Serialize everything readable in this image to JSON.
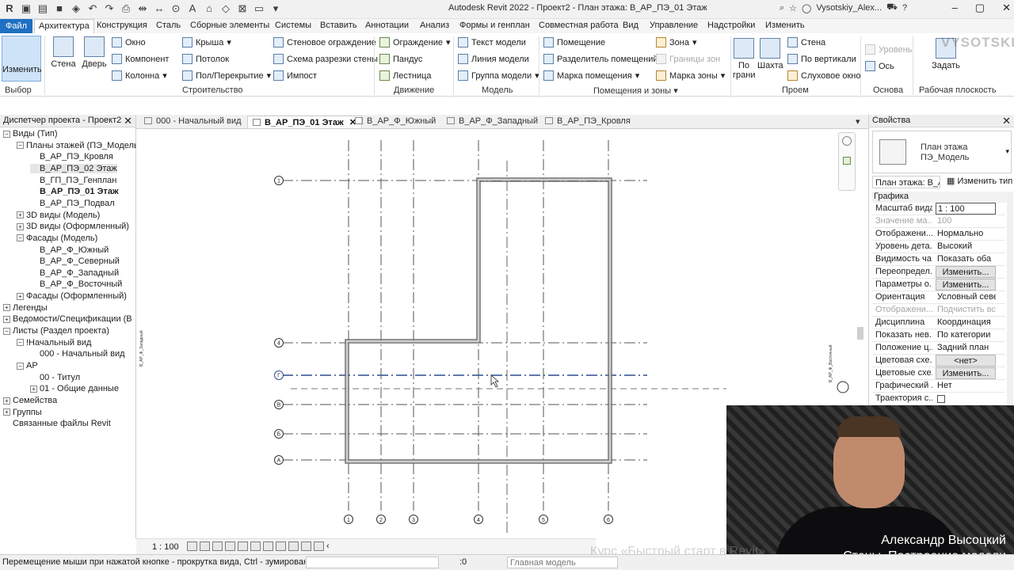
{
  "window": {
    "title": "Autodesk Revit 2022 - Проект2 - План этажа: В_АР_ПЭ_01 Этаж",
    "user": "Vysotskiy_Alex...",
    "logo_text": "VYSOTSKIY"
  },
  "menu": {
    "file": "Файл",
    "tabs": [
      "Архитектура",
      "Конструкция",
      "Сталь",
      "Сборные элементы",
      "Системы",
      "Вставить",
      "Аннотации",
      "Анализ",
      "Формы и генплан",
      "Совместная работа",
      "Вид",
      "Управление",
      "Надстройки",
      "Изменить"
    ],
    "active": "Архитектура"
  },
  "ribbon": {
    "modify": "Изменить",
    "select": "Выбор",
    "wall": "Стена",
    "door": "Дверь",
    "window": "Окно",
    "component": "Компонент",
    "column": "Колонна",
    "roof": "Крыша",
    "ceiling": "Потолок",
    "floor": "Пол/Перекрытие",
    "curtain_system": "Стеновое ограждение",
    "curtain_grid": "Схема разрезки стены",
    "mullion": "Импост",
    "railing": "Ограждение",
    "ramp": "Пандус",
    "stair": "Лестница",
    "model_text": "Текст модели",
    "model_line": "Линия модели",
    "model_group": "Группа модели",
    "room": "Помещение",
    "room_separator": "Разделитель помещений",
    "room_tag": "Марка помещения",
    "area": "Зона",
    "area_boundary": "Границы зон",
    "area_tag": "Марка зоны",
    "by_face": "По грани",
    "shaft": "Шахта",
    "opening_wall": "Стена",
    "vertical": "По вертикали",
    "dormer": "Слуховое окно",
    "level": "Уровень",
    "grid": "Ось",
    "set": "Задать",
    "panels": {
      "build": "Строительство",
      "circulation": "Движение",
      "model": "Модель",
      "room_area": "Помещения и зоны",
      "opening": "Проем",
      "datum": "Основа",
      "workplane": "Рабочая плоскость"
    }
  },
  "project_browser": {
    "title": "Диспетчер проекта - Проект2",
    "items": [
      {
        "label": "Виды (Тип)",
        "level": 0,
        "toggle": "−"
      },
      {
        "label": "Планы этажей (ПЭ_Модель",
        "level": 1,
        "toggle": "−"
      },
      {
        "label": "В_АР_ПЭ_Кровля",
        "level": 2
      },
      {
        "label": "В_АР_ПЭ_02 Этаж",
        "level": 2,
        "selected": true
      },
      {
        "label": "В_ГП_ПЭ_Генплан",
        "level": 2
      },
      {
        "label": "В_АР_ПЭ_01 Этаж",
        "level": 2,
        "bold": true
      },
      {
        "label": "В_АР_ПЭ_Подвал",
        "level": 2
      },
      {
        "label": "3D виды (Модель)",
        "level": 1,
        "toggle": "+"
      },
      {
        "label": "3D виды (Оформленный)",
        "level": 1,
        "toggle": "+"
      },
      {
        "label": "Фасады (Модель)",
        "level": 1,
        "toggle": "−"
      },
      {
        "label": "В_АР_Ф_Южный",
        "level": 2
      },
      {
        "label": "В_АР_Ф_Северный",
        "level": 2
      },
      {
        "label": "В_АР_Ф_Западный",
        "level": 2
      },
      {
        "label": "В_АР_Ф_Восточный",
        "level": 2
      },
      {
        "label": "Фасады (Оформленный)",
        "level": 1,
        "toggle": "+"
      },
      {
        "label": "Легенды",
        "level": 0,
        "toggle": "+"
      },
      {
        "label": "Ведомости/Спецификации (В",
        "level": 0,
        "toggle": "+"
      },
      {
        "label": "Листы (Раздел проекта)",
        "level": 0,
        "toggle": "−"
      },
      {
        "label": "!Начальный вид",
        "level": 1,
        "toggle": "−"
      },
      {
        "label": "000 - Начальный вид",
        "level": 2
      },
      {
        "label": "АР",
        "level": 1,
        "toggle": "−"
      },
      {
        "label": "00 - Титул",
        "level": 2
      },
      {
        "label": "01 - Общие данные",
        "level": 2,
        "toggle": "+"
      },
      {
        "label": "Семейства",
        "level": 0,
        "toggle": "+"
      },
      {
        "label": "Группы",
        "level": 0,
        "toggle": "+"
      },
      {
        "label": "Связанные файлы Revit",
        "level": 0
      }
    ]
  },
  "view_tabs": [
    {
      "label": "000 - Начальный вид"
    },
    {
      "label": "В_АР_ПЭ_01 Этаж",
      "active": true
    },
    {
      "label": "В_АР_Ф_Южный"
    },
    {
      "label": "В_АР_Ф_Западный"
    },
    {
      "label": "В_АР_ПЭ_Кровля"
    }
  ],
  "drawing": {
    "horizontal_grids": [
      "1",
      "4",
      "Г",
      "В",
      "Б",
      "А"
    ],
    "vertical_grids": [
      "1",
      "2",
      "3",
      "4",
      "5",
      "6"
    ],
    "left_elevation_tag": "В_АР_Ф_Западный",
    "right_elevation_tag": "В_АР_Ф_Восточный",
    "accent_color": "#2a4d8f"
  },
  "properties": {
    "title": "Свойства",
    "type_name_1": "План этажа",
    "type_name_2": "ПЭ_Модель",
    "instance_selector": "План этажа: В_А",
    "edit_type": "Изменить тип",
    "section": "Графика",
    "rows": [
      {
        "key": "Масштаб вида",
        "value": "1 : 100",
        "kind": "field"
      },
      {
        "key": "Значение ма...",
        "value": "100",
        "kind": "dis"
      },
      {
        "key": "Отображени...",
        "value": "Нормально"
      },
      {
        "key": "Уровень дета...",
        "value": "Высокий"
      },
      {
        "key": "Видимость ча...",
        "value": "Показать оба"
      },
      {
        "key": "Переопредел...",
        "value": "Изменить...",
        "kind": "btn"
      },
      {
        "key": "Параметры о...",
        "value": "Изменить...",
        "kind": "btn"
      },
      {
        "key": "Ориентация",
        "value": "Условный север"
      },
      {
        "key": "Отображени...",
        "value": "Подчистить вс...",
        "kind": "dis"
      },
      {
        "key": "Дисциплина",
        "value": "Координация"
      },
      {
        "key": "Показать нев...",
        "value": "По категории"
      },
      {
        "key": "Положение ц...",
        "value": "Задний план"
      },
      {
        "key": "Цветовая схе...",
        "value": "<нет>",
        "kind": "btn"
      },
      {
        "key": "Цветовые схе...",
        "value": "Изменить...",
        "kind": "btn"
      },
      {
        "key": "Графический ...",
        "value": "Нет"
      },
      {
        "key": "Траектория с...",
        "value": "",
        "kind": "check"
      }
    ]
  },
  "video": {
    "presenter": "Александр Высоцкий",
    "lesson": "Стены. Построение модели",
    "course_watermark": "Курс «Быстрый старт в Revit»"
  },
  "status": {
    "message": "Перемещение мыши при нажатой кнопке - прокрутка вида, Ctrl - зумирован",
    "count": ":0",
    "model": "Главная модель",
    "scale": "1 : 100"
  }
}
